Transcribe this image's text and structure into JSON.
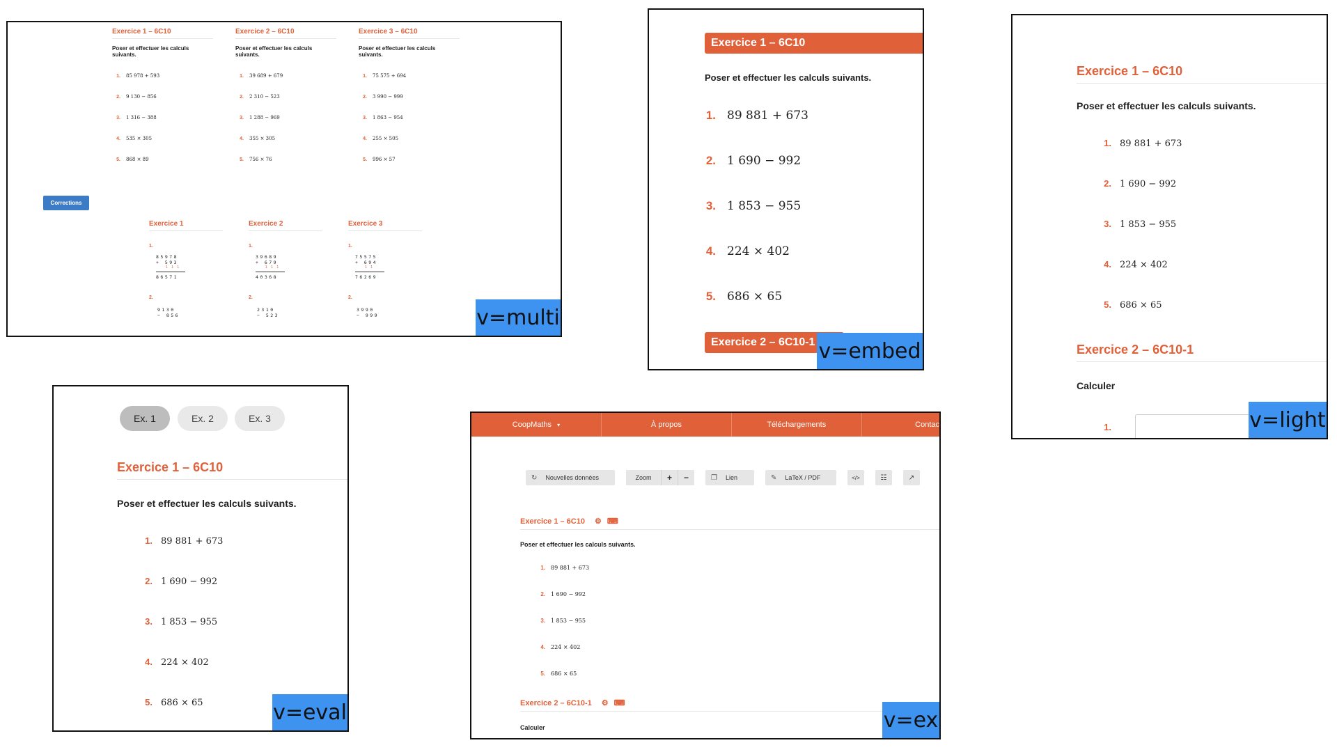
{
  "colors": {
    "accent": "#e0603a",
    "tag_bg": "#3e93f0",
    "button_blue": "#3c7bc6"
  },
  "multi": {
    "tag": "v=multi",
    "exercises": [
      {
        "title": "Exercice 1 – 6C10",
        "instruction": "Poser et effectuer les calculs suivants.",
        "questions": [
          {
            "n": "1.",
            "e": "85 978 + 593"
          },
          {
            "n": "2.",
            "e": "9 130 − 856"
          },
          {
            "n": "3.",
            "e": "1 316 − 388"
          },
          {
            "n": "4.",
            "e": "535 × 305"
          },
          {
            "n": "5.",
            "e": "868 × 89"
          }
        ]
      },
      {
        "title": "Exercice 2 – 6C10",
        "instruction": "Poser et effectuer les calculs suivants.",
        "questions": [
          {
            "n": "1.",
            "e": "39 689 + 679"
          },
          {
            "n": "2.",
            "e": "2 310 − 523"
          },
          {
            "n": "3.",
            "e": "1 288 − 969"
          },
          {
            "n": "4.",
            "e": "355 × 305"
          },
          {
            "n": "5.",
            "e": "756 × 76"
          }
        ]
      },
      {
        "title": "Exercice 3 – 6C10",
        "instruction": "Poser et effectuer les calculs suivants.",
        "questions": [
          {
            "n": "1.",
            "e": "75 575 + 694"
          },
          {
            "n": "2.",
            "e": "3 990 − 999"
          },
          {
            "n": "3.",
            "e": "1 863 − 954"
          },
          {
            "n": "4.",
            "e": "255 × 505"
          },
          {
            "n": "5.",
            "e": "996 × 57"
          }
        ]
      }
    ],
    "corrections_button": "Corrections",
    "corrections": [
      {
        "title": "Exercice 1",
        "n1": "1.",
        "top": "85978",
        "op": "+  593",
        "carry": "1 1 1",
        "res": "86571",
        "n2": "2.",
        "top2": "9130",
        "op2": "−  856"
      },
      {
        "title": "Exercice 2",
        "n1": "1.",
        "top": "39689",
        "op": "+  679",
        "carry": "1 1 1",
        "res": "40368",
        "n2": "2.",
        "top2": "2310",
        "op2": "−  523"
      },
      {
        "title": "Exercice 3",
        "n1": "1.",
        "top": "75575",
        "op": "+  694",
        "carry": "1 1",
        "res": "76269",
        "n2": "2.",
        "top2": "3990",
        "op2": "−  999"
      }
    ]
  },
  "embed": {
    "tag": "v=embed",
    "ex1_title": "Exercice 1 – 6C10",
    "instruction": "Poser et effectuer les calculs suivants.",
    "questions": [
      {
        "n": "1.",
        "e": "89 881 + 673"
      },
      {
        "n": "2.",
        "e": "1 690 − 992"
      },
      {
        "n": "3.",
        "e": "1 853 − 955"
      },
      {
        "n": "4.",
        "e": "224 × 402"
      },
      {
        "n": "5.",
        "e": "686 × 65"
      }
    ],
    "ex2_title": "Exercice 2 – 6C10-1"
  },
  "light": {
    "tag": "v=light",
    "ex1_title": "Exercice 1 – 6C10",
    "instruction": "Poser et effectuer les calculs suivants.",
    "questions": [
      {
        "n": "1.",
        "e": "89 881 + 673"
      },
      {
        "n": "2.",
        "e": "1 690 − 992"
      },
      {
        "n": "3.",
        "e": "1 853 − 955"
      },
      {
        "n": "4.",
        "e": "224 × 402"
      },
      {
        "n": "5.",
        "e": "686 × 65"
      }
    ],
    "ex2_title": "Exercice 2 – 6C10-1",
    "ex2_instruction": "Calculer",
    "ex2_q1": "1."
  },
  "eval": {
    "tag": "v=eval",
    "tabs": [
      {
        "label": "Ex. 1",
        "active": true
      },
      {
        "label": "Ex. 2",
        "active": false
      },
      {
        "label": "Ex. 3",
        "active": false
      }
    ],
    "ex1_title": "Exercice 1 – 6C10",
    "instruction": "Poser et effectuer les calculs suivants.",
    "questions": [
      {
        "n": "1.",
        "e": "89 881 + 673"
      },
      {
        "n": "2.",
        "e": "1 690 − 992"
      },
      {
        "n": "3.",
        "e": "1 853 − 955"
      },
      {
        "n": "4.",
        "e": "224 × 402"
      },
      {
        "n": "5.",
        "e": "686 × 65"
      }
    ]
  },
  "ex": {
    "tag": "v=ex",
    "nav": {
      "brand": "CoopMaths",
      "brand_caret": "▾",
      "about": "À propos",
      "downloads": "Téléchargements",
      "contact": "Contac"
    },
    "toolbar": {
      "new_data": "Nouvelles données",
      "new_data_icon": "refresh-icon",
      "zoom": "Zoom",
      "zoom_plus": "+",
      "zoom_minus": "−",
      "link": "Lien",
      "link_icon": "copy-icon",
      "latex": "LaTeX / PDF",
      "latex_icon": "edit-icon",
      "code_icon": "code-icon",
      "grid_icon": "grid-icon",
      "external_icon": "external-link-icon"
    },
    "ex1_title": "Exercice 1 – 6C10",
    "instruction": "Poser et effectuer les calculs suivants.",
    "questions": [
      {
        "n": "1.",
        "e": "89 881 + 673"
      },
      {
        "n": "2.",
        "e": "1 690 − 992"
      },
      {
        "n": "3.",
        "e": "1 853 − 955"
      },
      {
        "n": "4.",
        "e": "224 × 402"
      },
      {
        "n": "5.",
        "e": "686 × 65"
      }
    ],
    "ex2_title": "Exercice 2 – 6C10-1",
    "ex2_instruction": "Calculer"
  }
}
